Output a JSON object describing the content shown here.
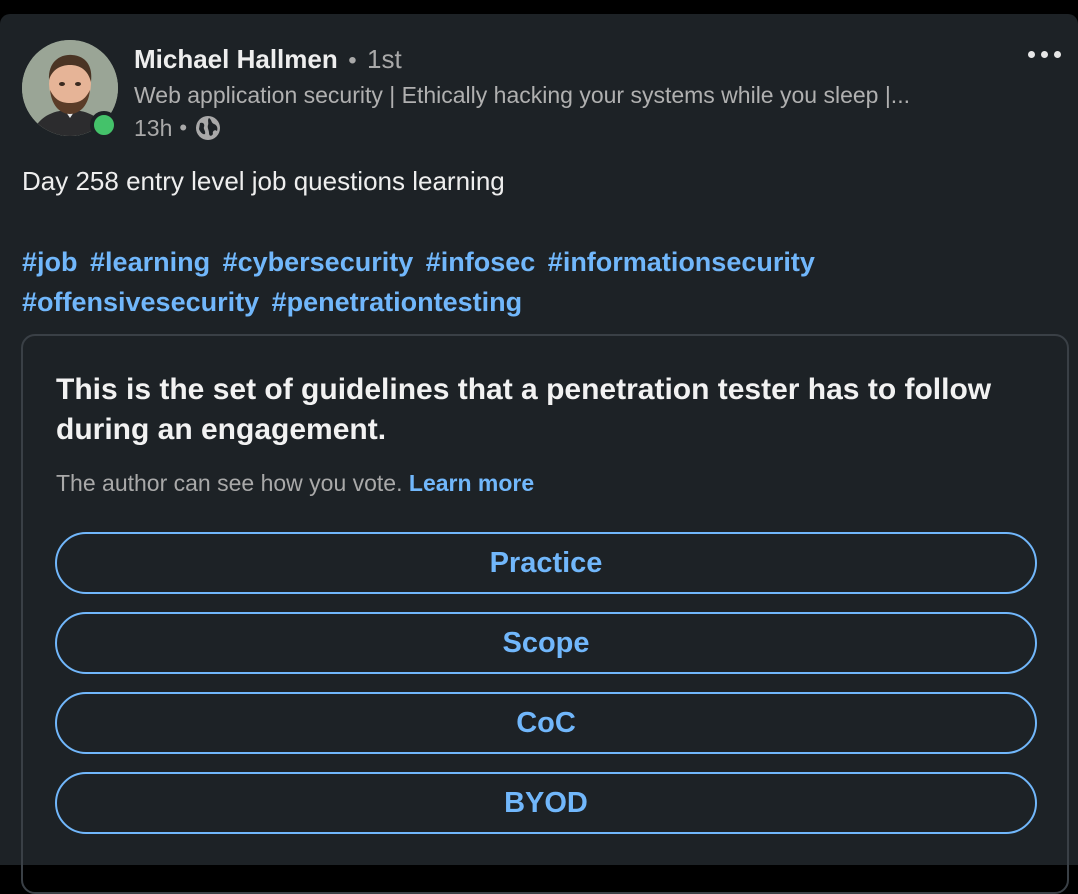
{
  "post": {
    "author": {
      "name": "Michael Hallmen",
      "separator": "•",
      "degree": "1st",
      "headline": "Web application security | Ethically hacking your systems while you sleep |...",
      "time": "13h",
      "time_separator": "•",
      "visibility_icon": "globe-icon",
      "online_status": "online"
    },
    "more_icon": "more-horizontal-icon",
    "text": "Day 258 entry level job questions learning",
    "hashtags": [
      "#job",
      "#learning",
      "#cybersecurity",
      "#infosec",
      "#informationsecurity",
      "#offensivesecurity",
      "#penetrationtesting"
    ]
  },
  "poll": {
    "question": "This is the set of guidelines that a penetration tester has to follow during an engagement.",
    "vote_note": "The author can see how you vote.",
    "learn_more": "Learn more",
    "options": [
      "Practice",
      "Scope",
      "CoC",
      "BYOD"
    ]
  },
  "colors": {
    "card_background": "#1d2226",
    "link": "#71b7fb",
    "online": "#44c26a"
  }
}
